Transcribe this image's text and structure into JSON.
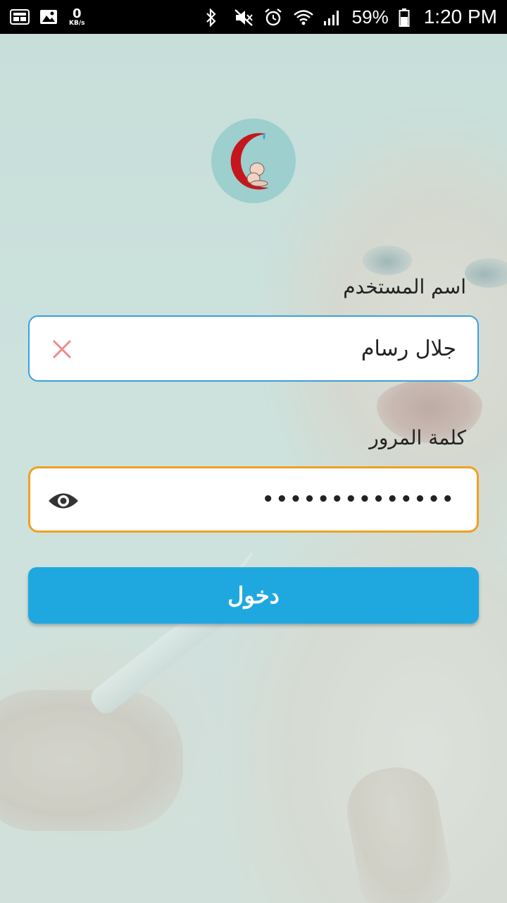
{
  "status_bar": {
    "net_speed_value": "0",
    "net_speed_unit": "KB/s",
    "battery": "59%",
    "time": "1:20 PM"
  },
  "form": {
    "username_label": "اسم المستخدم",
    "username_value": "جلال رسام",
    "password_label": "كلمة المرور",
    "password_masked": "••••••••••••••",
    "login_button": "دخول"
  },
  "colors": {
    "accent": "#1fa8df",
    "focus_border": "#f0a020",
    "input_border": "#3aa0dc",
    "clear_icon": "#f08a8a"
  }
}
